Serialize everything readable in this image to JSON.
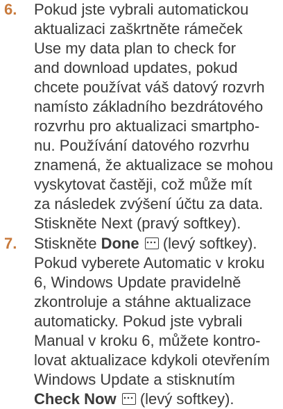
{
  "steps": [
    {
      "number": "6.",
      "lines": [
        "Pokud jste vybrali automatickou",
        "aktualizaci zaškrtněte rámeček",
        "Use my data plan to check for",
        "and download updates, pokud",
        "chcete používat váš datový rozvrh",
        "namísto základního bezdrátového",
        "rozvrhu pro aktualizaci smartpho-",
        "nu. Používání datového rozvrhu",
        "znamená, že aktualizace se mohou",
        "vyskytovat častěji, což může mít",
        "za následek zvýšení účtu za data.",
        "Stiskněte Next (pravý softkey)."
      ]
    },
    {
      "number": "7.",
      "line1_prefix": "Stiskněte ",
      "line1_bold": "Done",
      "line1_suffix": " (levý softkey).",
      "lines": [
        "Pokud vyberete Automatic v kroku",
        "6, Windows Update pravidelně",
        "zkontroluje a stáhne aktualizace",
        "automaticky. Pokud jste vybrali",
        "Manual v kroku 6, můžete kontro-",
        "lovat aktualizace kdykoli otevřením",
        "Windows Update a stisknutím"
      ],
      "last_bold": "Check Now",
      "last_suffix": " (levý softkey)."
    }
  ],
  "colors": {
    "step_number": "#c87a3c",
    "text": "#3a3a3a"
  },
  "icons": {
    "softkey": "menu-softkey-icon"
  }
}
